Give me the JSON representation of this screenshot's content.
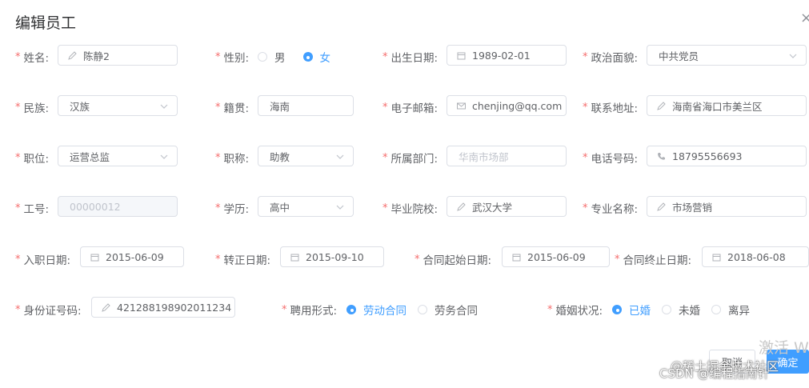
{
  "dialog": {
    "title": "编辑员工",
    "close_icon": "×"
  },
  "fields": {
    "name": {
      "label": "姓名:",
      "value": "陈静2",
      "icon": "edit-icon"
    },
    "gender": {
      "label": "性别:",
      "options": [
        "男",
        "女"
      ],
      "selected": "女"
    },
    "birth_date": {
      "label": "出生日期:",
      "value": "1989-02-01",
      "icon": "calendar-icon"
    },
    "political": {
      "label": "政治面貌:",
      "value": "中共党员"
    },
    "nation": {
      "label": "民族:",
      "value": "汉族"
    },
    "native": {
      "label": "籍贯:",
      "value": "海南"
    },
    "email": {
      "label": "电子邮箱:",
      "value": "chenjing@qq.com",
      "icon": "mail-icon"
    },
    "address": {
      "label": "联系地址:",
      "value": "海南省海口市美兰区",
      "icon": "edit-icon"
    },
    "position": {
      "label": "职位:",
      "value": "运营总监"
    },
    "job_title": {
      "label": "职称:",
      "value": "助教"
    },
    "department": {
      "label": "所属部门:",
      "value": "华南市场部"
    },
    "phone": {
      "label": "电话号码:",
      "value": "18795556693",
      "icon": "phone-icon"
    },
    "work_id": {
      "label": "工号:",
      "value": "00000012"
    },
    "education": {
      "label": "学历:",
      "value": "高中"
    },
    "school": {
      "label": "毕业院校:",
      "value": "武汉大学",
      "icon": "edit-icon"
    },
    "specialty": {
      "label": "专业名称:",
      "value": "市场营销",
      "icon": "edit-icon"
    },
    "entry_date": {
      "label": "入职日期:",
      "value": "2015-06-09",
      "icon": "calendar-icon"
    },
    "regular_date": {
      "label": "转正日期:",
      "value": "2015-09-10",
      "icon": "calendar-icon"
    },
    "contract_start": {
      "label": "合同起始日期:",
      "value": "2015-06-09",
      "icon": "calendar-icon"
    },
    "contract_end": {
      "label": "合同终止日期:",
      "value": "2018-06-08",
      "icon": "calendar-icon"
    },
    "id_card": {
      "label": "身份证号码:",
      "value": "421288198902011234",
      "icon": "edit-icon"
    },
    "engage_form": {
      "label": "聘用形式:",
      "options": [
        "劳动合同",
        "劳务合同"
      ],
      "selected": "劳动合同"
    },
    "wedlock": {
      "label": "婚姻状况:",
      "options": [
        "已婚",
        "未婚",
        "离异"
      ],
      "selected": "已婚"
    }
  },
  "footer": {
    "cancel_label": "取消",
    "confirm_label": "确定"
  },
  "overlay": {
    "activate_text": "激活 W",
    "watermark_1": "@稀土掘金技术社区",
    "watermark_2": "CSDN @编程指南针"
  },
  "colors": {
    "primary": "#409eff",
    "required": "#f56c6c",
    "border": "#dcdfe6"
  }
}
